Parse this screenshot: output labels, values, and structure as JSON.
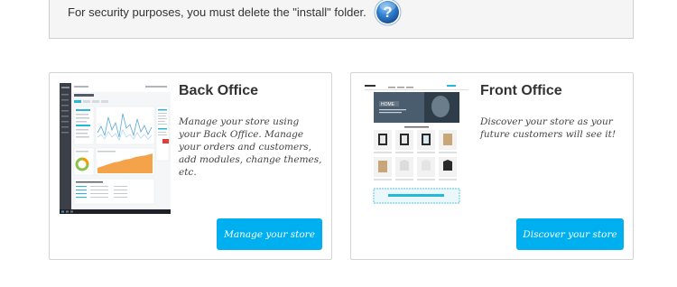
{
  "notice": {
    "text": "For security purposes, you must delete the \"install\" folder.",
    "icon": "question-circle-icon"
  },
  "cards": [
    {
      "title": "Back Office",
      "description": "Manage your store using your Back Office. Manage your orders and customers, add modules, change themes, etc.",
      "button_label": "Manage your store",
      "thumbnail": "back-office-dashboard-screenshot"
    },
    {
      "title": "Front Office",
      "description": "Discover your store as your future customers will see it!",
      "button_label": "Discover your store",
      "thumbnail": "front-office-storefront-screenshot"
    }
  ],
  "colors": {
    "button": "#00aff0",
    "help_icon": "#2f7fcf",
    "notice_bg": "#f5f5f5"
  }
}
